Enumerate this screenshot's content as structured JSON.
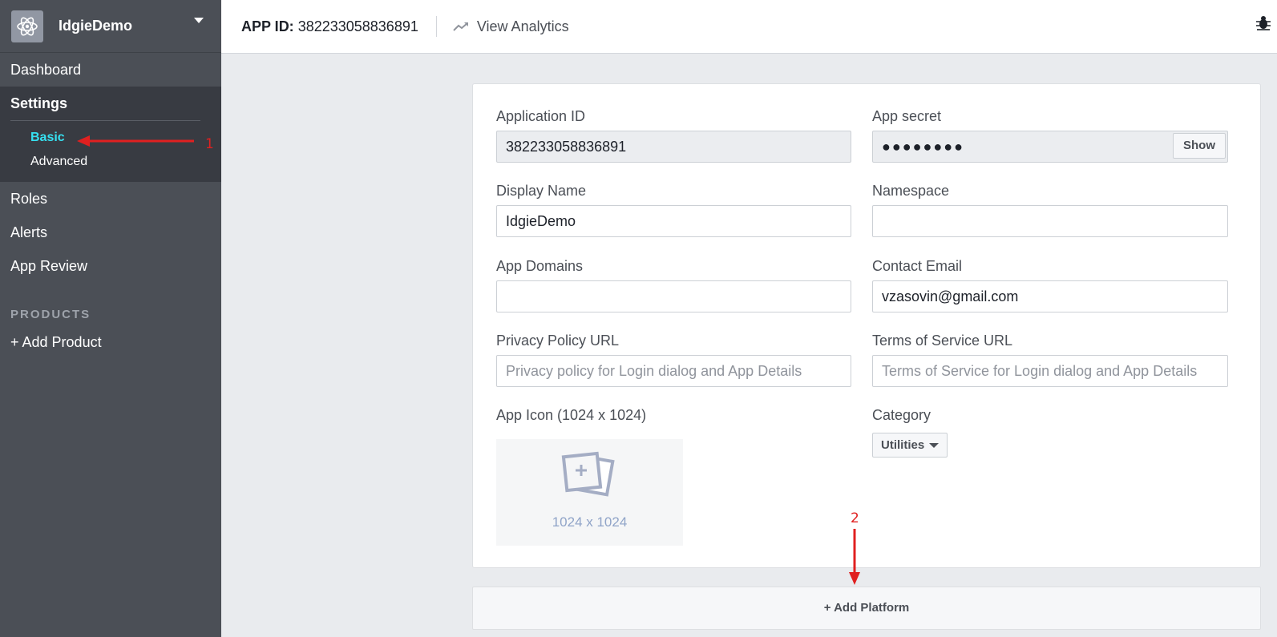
{
  "sidebar": {
    "app_name": "IdgieDemo",
    "items": {
      "dashboard": "Dashboard",
      "settings": "Settings",
      "basic": "Basic",
      "advanced": "Advanced",
      "roles": "Roles",
      "alerts": "Alerts",
      "app_review": "App Review"
    },
    "products_heading": "PRODUCTS",
    "add_product": "+ Add Product"
  },
  "topbar": {
    "app_id_label": "APP ID:",
    "app_id_value": "382233058836891",
    "analytics_label": "View Analytics"
  },
  "form": {
    "application_id": {
      "label": "Application ID",
      "value": "382233058836891"
    },
    "app_secret": {
      "label": "App secret",
      "value": "●●●●●●●●",
      "show_button": "Show"
    },
    "display_name": {
      "label": "Display Name",
      "value": "IdgieDemo"
    },
    "namespace": {
      "label": "Namespace",
      "value": ""
    },
    "app_domains": {
      "label": "App Domains",
      "value": ""
    },
    "contact_email": {
      "label": "Contact Email",
      "value": "vzasovin@gmail.com"
    },
    "privacy_policy": {
      "label": "Privacy Policy URL",
      "placeholder": "Privacy policy for Login dialog and App Details"
    },
    "terms_of_service": {
      "label": "Terms of Service URL",
      "placeholder": "Terms of Service for Login dialog and App Details"
    },
    "app_icon": {
      "label": "App Icon (1024 x 1024)",
      "placeholder_text": "1024 x 1024"
    },
    "category": {
      "label": "Category",
      "value": "Utilities"
    }
  },
  "add_platform": "+ Add Platform",
  "annotations": {
    "first": "1",
    "second": "2"
  },
  "colors": {
    "sidebar_bg": "#4b4f56",
    "active_link": "#36e0f0",
    "annotation": "#e02020"
  }
}
